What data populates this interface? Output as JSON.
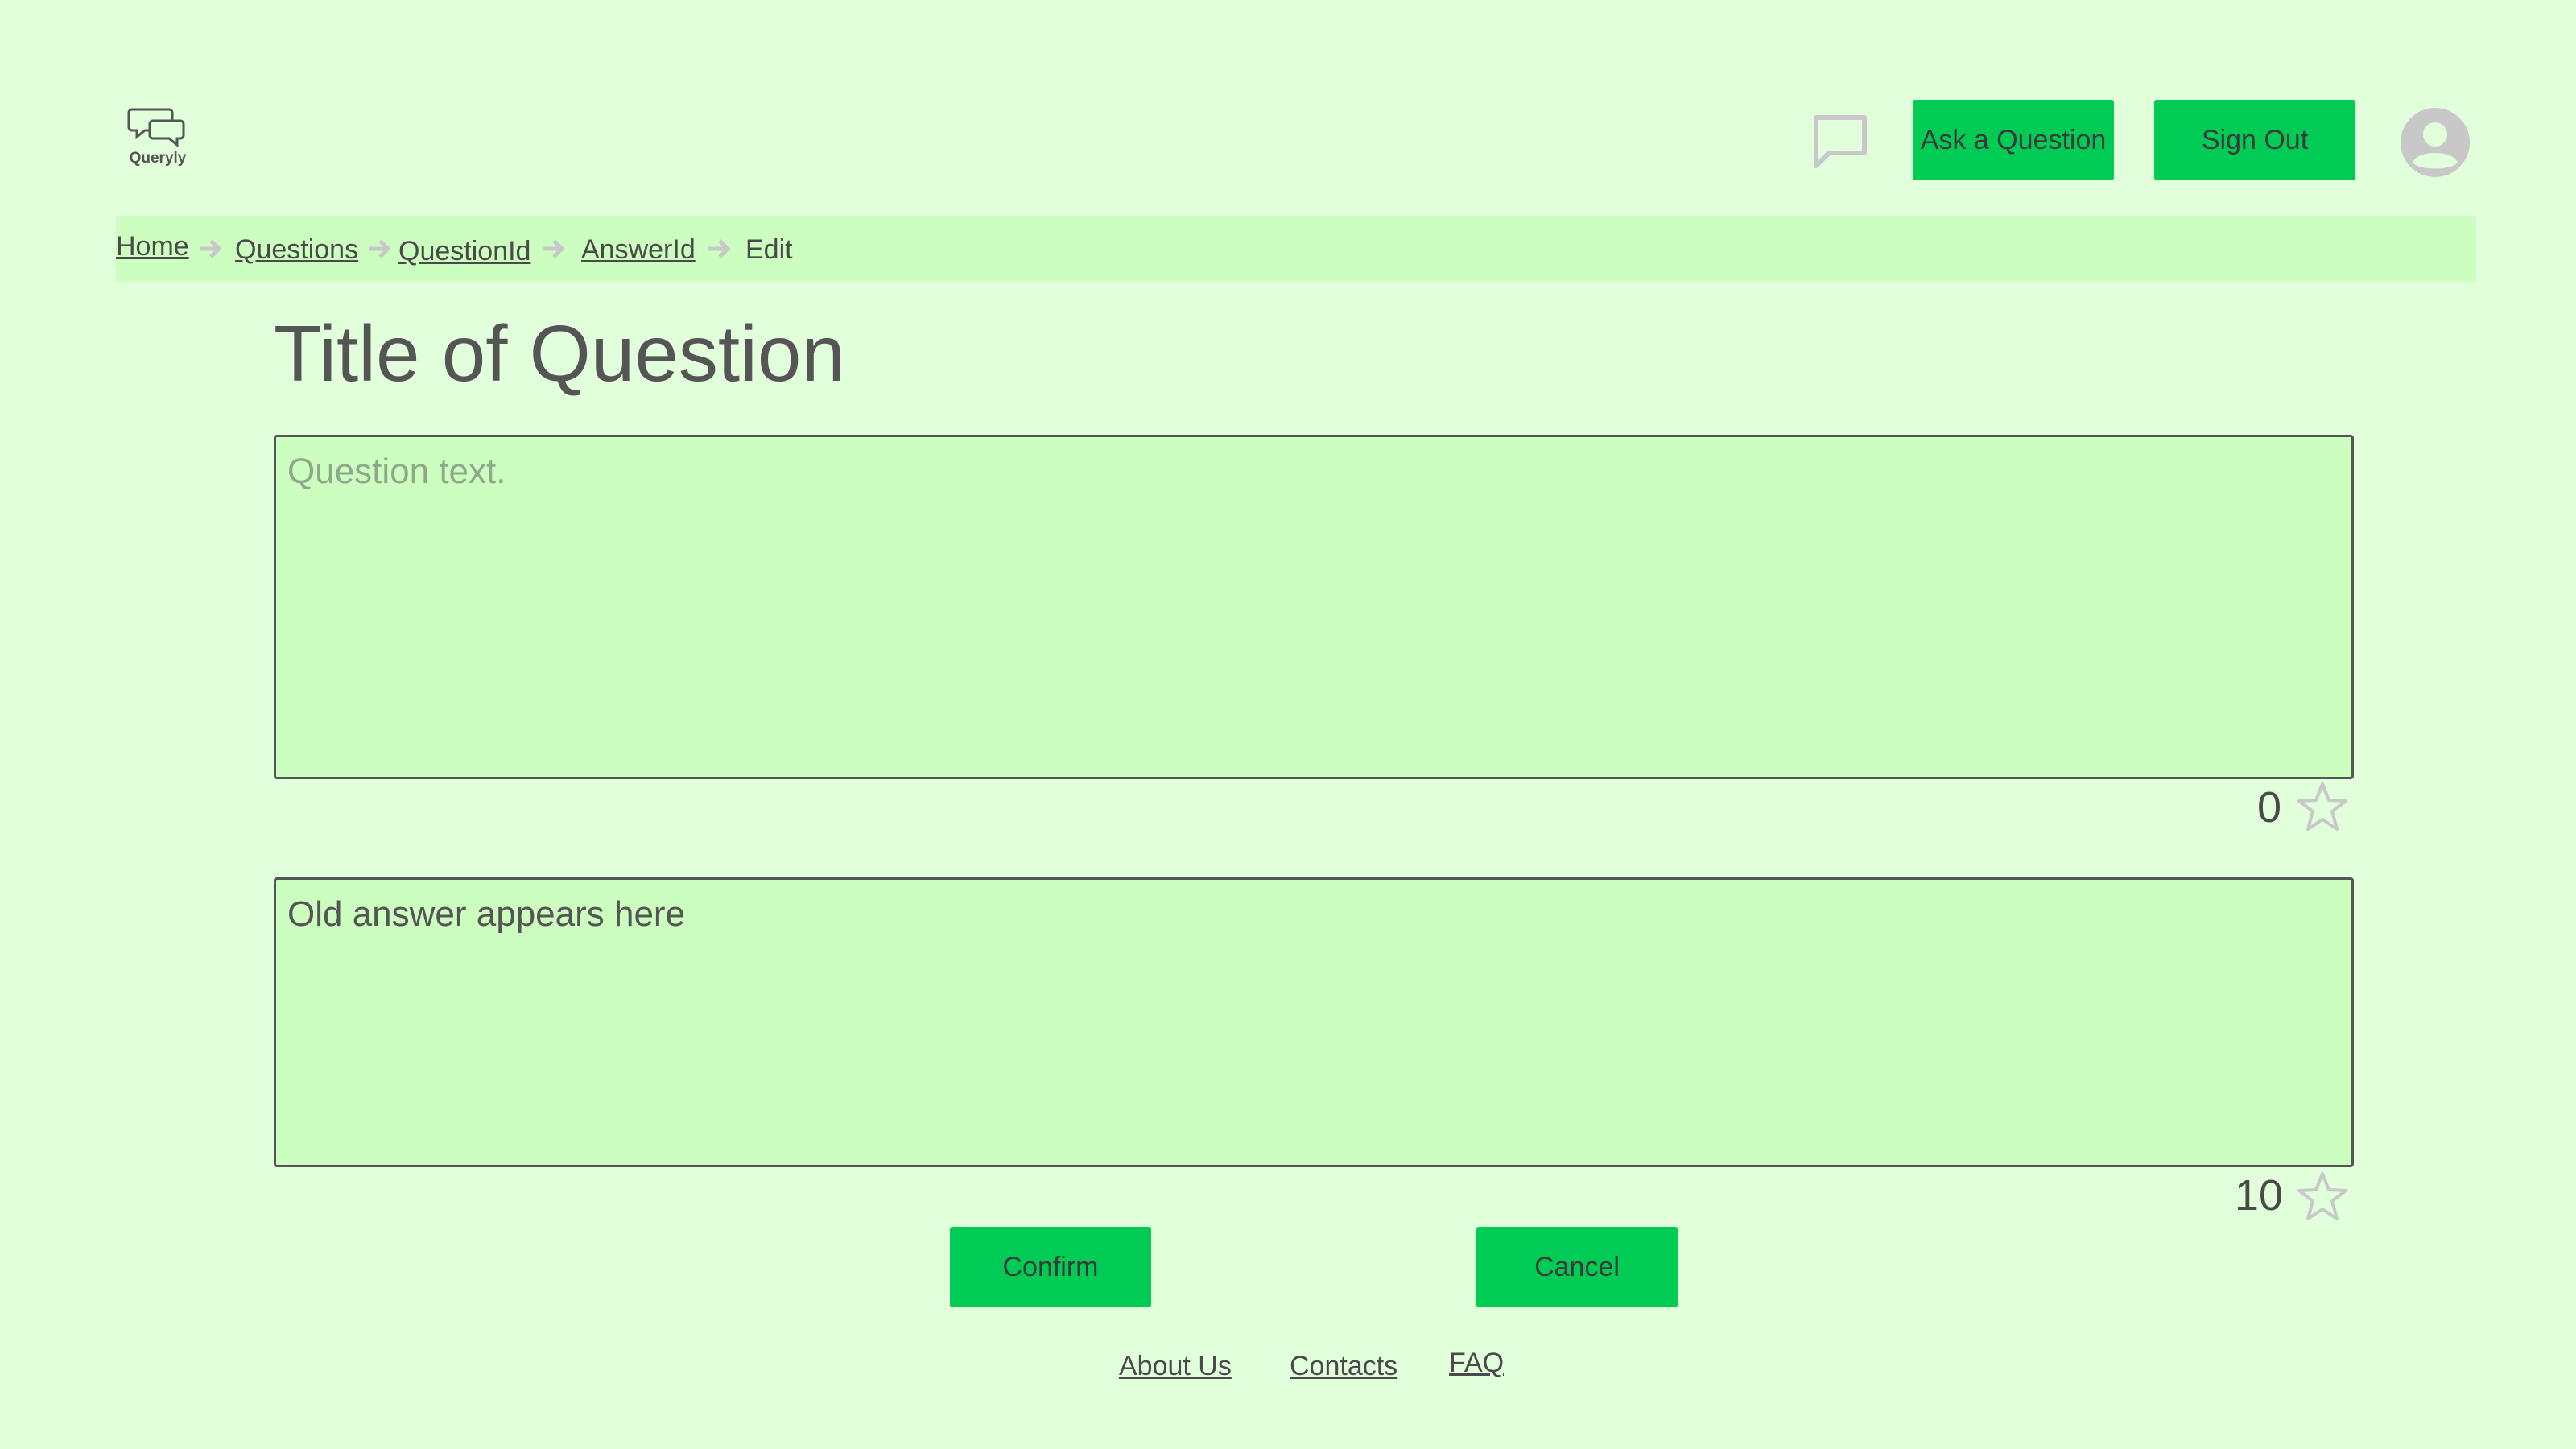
{
  "header": {
    "logo_text": "Queryly",
    "ask_button_label": "Ask a Question",
    "sign_out_label": "Sign Out",
    "icons": [
      "chat-icon",
      "avatar-icon"
    ]
  },
  "breadcrumb": {
    "items": [
      {
        "label": "Home",
        "link": true
      },
      {
        "label": "Questions",
        "link": true
      },
      {
        "label": "QuestionId",
        "link": true
      },
      {
        "label": "AnswerId",
        "link": true
      },
      {
        "label": "Edit",
        "link": false
      }
    ]
  },
  "question": {
    "title": "Title of Question",
    "placeholder": "Question text.",
    "score": "0"
  },
  "answer": {
    "value": "Old answer appears here",
    "score": "10"
  },
  "actions": {
    "confirm_label": "Confirm",
    "cancel_label": "Cancel"
  },
  "footer": {
    "links": [
      "About Us",
      "Contacts",
      "FAQ"
    ]
  },
  "colors": {
    "background": "#e0ffda",
    "panel": "#ccffbf",
    "accent": "#00cc55",
    "text": "#555555",
    "icon_gray": "#c8c8c8"
  }
}
